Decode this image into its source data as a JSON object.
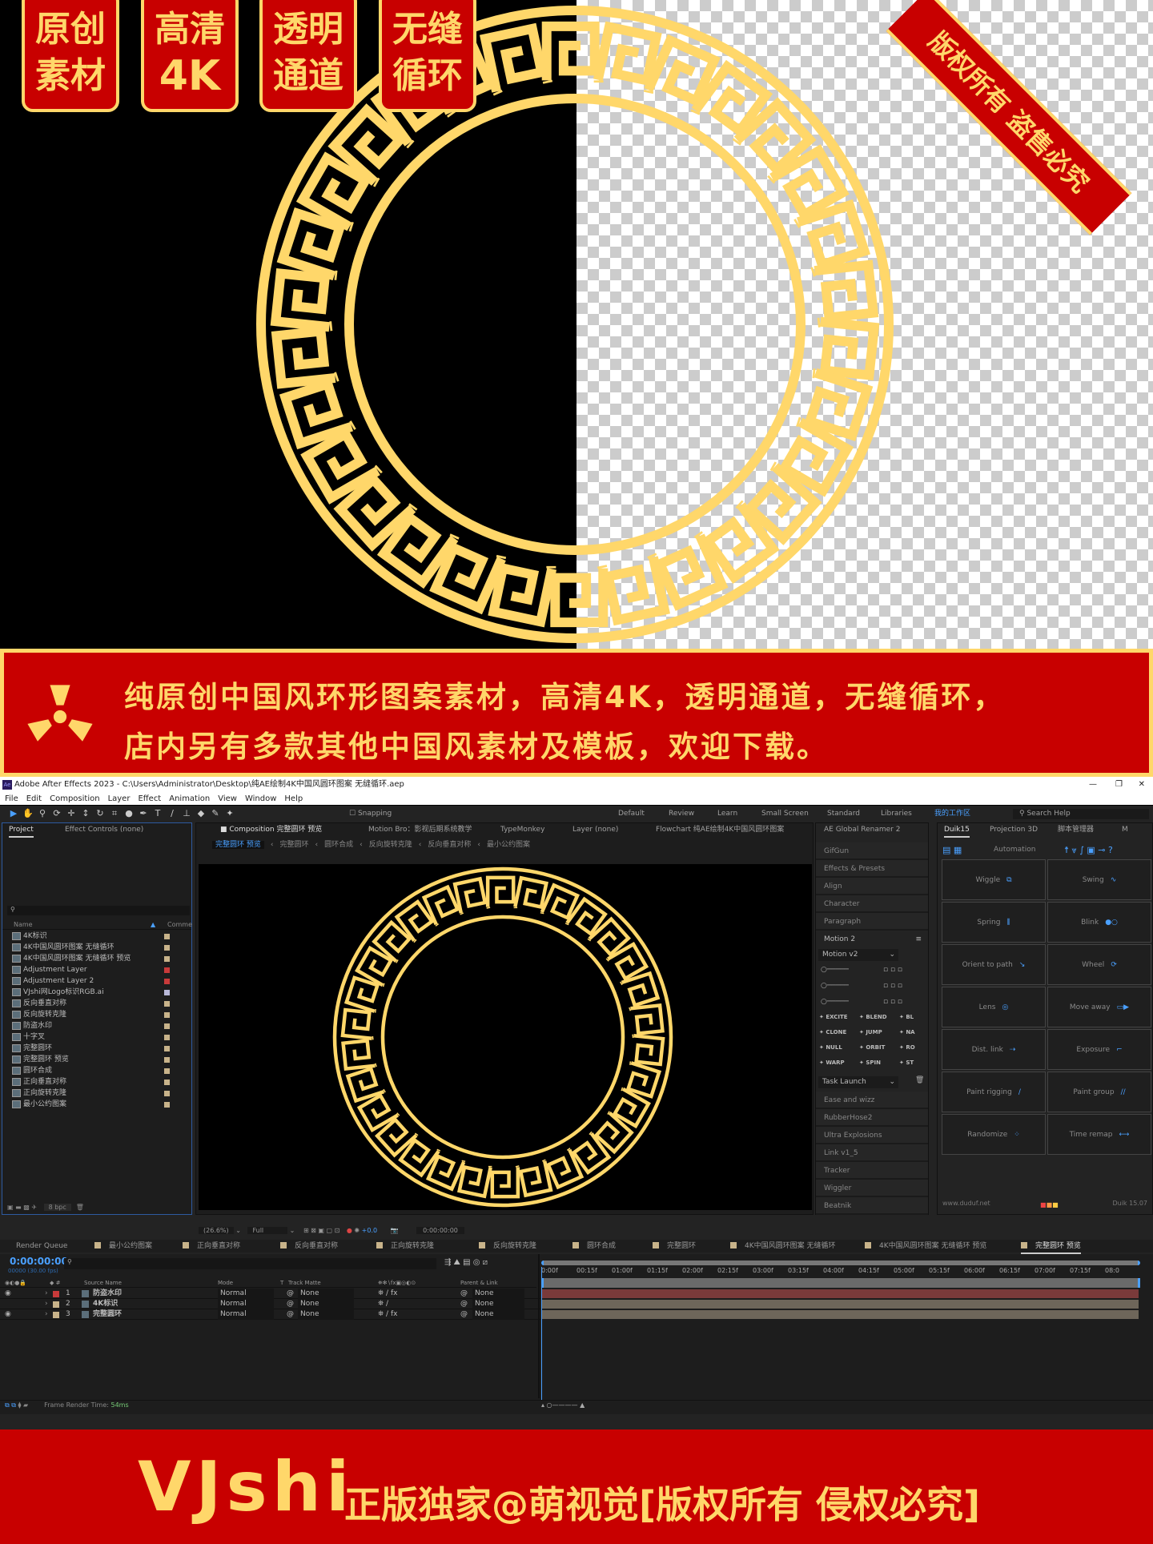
{
  "hero": {
    "badges": [
      {
        "line1": "原创",
        "line2": "素材"
      },
      {
        "line1": "高清",
        "line2": "4K"
      },
      {
        "line1": "透明",
        "line2": "通道"
      },
      {
        "line1": "无缝",
        "line2": "循环"
      }
    ],
    "ribbon": "版权所有 盗售必究",
    "colors": {
      "red": "#c80000",
      "gold": "#ffd76a"
    }
  },
  "banner": {
    "icon": "radiation-icon",
    "line1": "纯原创中国风环形图案素材，高清4K，透明通道，无缝循环，",
    "line2": "店内另有多款其他中国风素材及模板，欢迎下载。"
  },
  "ae": {
    "title": "Adobe After Effects 2023 - C:\\Users\\Administrator\\Desktop\\纯AE绘制4K中国风圆环图案 无缝循环.aep",
    "menu": [
      "File",
      "Edit",
      "Composition",
      "Layer",
      "Effect",
      "Animation",
      "View",
      "Window",
      "Help"
    ],
    "snapping": "Snapping",
    "workspaces": [
      "Default",
      "Review",
      "Learn",
      "Small Screen",
      "Standard",
      "Libraries"
    ],
    "active_workspace": "我的工作区",
    "search_help": "Search Help",
    "project": {
      "tabs": [
        "Project",
        "Effect Controls (none)"
      ],
      "col_name": "Name",
      "col_comment": "Comme",
      "items": [
        {
          "name": "4K标识",
          "color": "#c8b38a"
        },
        {
          "name": "4K中国风圆环图案 无缝循环",
          "color": "#c8b38a"
        },
        {
          "name": "4K中国风圆环图案 无缝循环 预览",
          "color": "#c8b38a"
        },
        {
          "name": "Adjustment Layer",
          "color": "#c83a3a"
        },
        {
          "name": "Adjustment Layer 2",
          "color": "#c83a3a"
        },
        {
          "name": "VJshi网Logo标识RGB.ai",
          "color": "#b8b8d8"
        },
        {
          "name": "反向垂直对称",
          "color": "#c8b38a"
        },
        {
          "name": "反向旋转克隆",
          "color": "#c8b38a"
        },
        {
          "name": "防盗水印",
          "color": "#c8b38a"
        },
        {
          "name": "十字叉",
          "color": "#c8b38a"
        },
        {
          "name": "完整圆环",
          "color": "#c8b38a"
        },
        {
          "name": "完整圆环 预览",
          "color": "#c8b38a"
        },
        {
          "name": "圆环合成",
          "color": "#c8b38a"
        },
        {
          "name": "正向垂直对称",
          "color": "#c8b38a"
        },
        {
          "name": "正向旋转克隆",
          "color": "#c8b38a"
        },
        {
          "name": "最小公约图案",
          "color": "#c8b38a"
        }
      ],
      "bpc": "8 bpc"
    },
    "comp": {
      "tabs": [
        "Composition 完整圆环 预览",
        "Motion Bro：影视后期系统教学",
        "TypeMonkey",
        "Layer (none)",
        "Flowchart 纯AE绘制4K中国风圆环图案"
      ],
      "breadcrumb": [
        "完整圆环 预览",
        "完整圆环",
        "圆环合成",
        "反向旋转克隆",
        "反向垂直对称",
        "最小公约图案"
      ],
      "zoom": "(26.6%)",
      "resolution": "Full",
      "exposure": "+0.0",
      "timecode": "0:00:00:00"
    },
    "middle": {
      "header": "AE Global Renamer 2",
      "top_items": [
        "GifGun",
        "Effects & Presets",
        "Align",
        "Character",
        "Paragraph"
      ],
      "motion_title": "Motion 2",
      "motion_select": "Motion v2",
      "motion_tools": [
        "EXCITE",
        "BLEND",
        "BL",
        "CLONE",
        "JUMP",
        "NA",
        "NULL",
        "ORBIT",
        "RO",
        "WARP",
        "SPIN",
        "ST"
      ],
      "task_select": "Task Launch",
      "bottom_items": [
        "Ease and wizz",
        "RubberHose2",
        "Ultra Explosions",
        "Link v1_5",
        "Tracker",
        "Wiggler",
        "Beatnik"
      ]
    },
    "duik": {
      "tabs": [
        "Duik15",
        "Projection 3D",
        "脚本管理器",
        "M"
      ],
      "automation": "Automation",
      "buttons": [
        "Wiggle",
        "Swing",
        "Spring",
        "Blink",
        "Orient to path",
        "Wheel",
        "Lens",
        "Move away",
        "Dist. link",
        "Exposure",
        "Paint rigging",
        "Paint group",
        "Randomize",
        "Time remap"
      ],
      "url": "www.duduf.net",
      "version": "Duik 15.07"
    },
    "timeline": {
      "tabs": [
        "Render Queue",
        "最小公约图案",
        "正向垂直对称",
        "反向垂直对称",
        "正向旋转克隆",
        "反向旋转克隆",
        "圆环合成",
        "完整圆环",
        "4K中国风圆环图案 无缝循环",
        "4K中国风圆环图案 无缝循环 预览",
        "完整圆环 预览"
      ],
      "current_time": "0:00:00:00",
      "frame_info": "00000 (30.00 fps)",
      "columns": {
        "source": "Source Name",
        "mode": "Mode",
        "t": "T",
        "matte": "Track Matte",
        "parent": "Parent & Link"
      },
      "layers": [
        {
          "num": "1",
          "name": "防盗水印",
          "mode": "Normal",
          "matte": "None",
          "parent": "None",
          "color": "#c83a3a",
          "bar": "#7a3a3a",
          "visible": true
        },
        {
          "num": "2",
          "name": "4K标识",
          "mode": "Normal",
          "matte": "None",
          "parent": "None",
          "color": "#c8b38a",
          "bar": "#6e665a",
          "visible": false
        },
        {
          "num": "3",
          "name": "完整圆环",
          "mode": "Normal",
          "matte": "None",
          "parent": "None",
          "color": "#c8b38a",
          "bar": "#6e665a",
          "visible": true
        }
      ],
      "ruler": [
        "0:00f",
        "00:15f",
        "01:00f",
        "01:15f",
        "02:00f",
        "02:15f",
        "03:00f",
        "03:15f",
        "04:00f",
        "04:15f",
        "05:00f",
        "05:15f",
        "06:00f",
        "06:15f",
        "07:00f",
        "07:15f",
        "08:0"
      ],
      "render_time_label": "Frame Render Time:",
      "render_time": "54ms"
    }
  },
  "footer": {
    "logo": "VJshi",
    "text": "正版独家@萌视觉[版权所有 侵权必究]"
  }
}
